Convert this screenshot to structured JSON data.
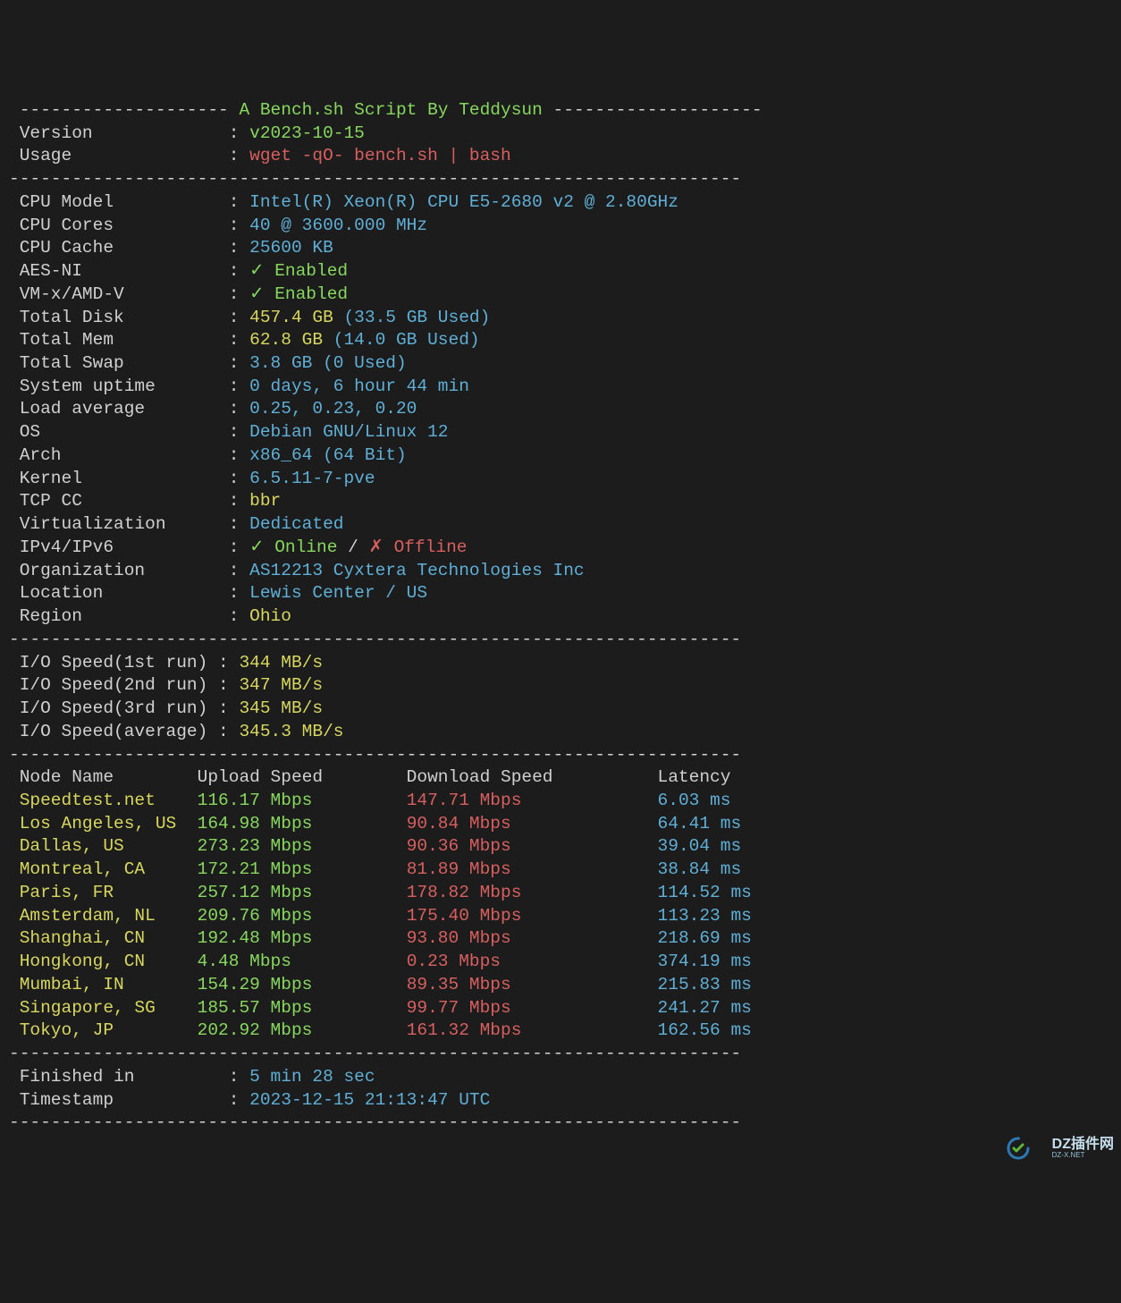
{
  "header": {
    "dash_left": "-------------------- ",
    "title": "A Bench.sh Script By Teddysun",
    "dash_right": " --------------------"
  },
  "version": {
    "label": "Version",
    "value": "v2023-10-15"
  },
  "usage": {
    "label": "Usage",
    "value": "wget -qO- bench.sh | bash"
  },
  "dash70": "----------------------------------------------------------------------",
  "sys": {
    "cpu_model": {
      "label": "CPU Model",
      "value": "Intel(R) Xeon(R) CPU E5-2680 v2 @ 2.80GHz"
    },
    "cpu_cores": {
      "label": "CPU Cores",
      "value": "40 @ 3600.000 MHz"
    },
    "cpu_cache": {
      "label": "CPU Cache",
      "value": "25600 KB"
    },
    "aes_ni": {
      "label": "AES-NI",
      "check": "✓",
      "value": "Enabled"
    },
    "vmx": {
      "label": "VM-x/AMD-V",
      "check": "✓",
      "value": "Enabled"
    },
    "total_disk": {
      "label": "Total Disk",
      "value": "457.4 GB",
      "used": "(33.5 GB Used)"
    },
    "total_mem": {
      "label": "Total Mem",
      "value": "62.8 GB",
      "used": "(14.0 GB Used)"
    },
    "total_swap": {
      "label": "Total Swap",
      "value": "3.8 GB (0 Used)"
    },
    "uptime": {
      "label": "System uptime",
      "value": "0 days, 6 hour 44 min"
    },
    "load": {
      "label": "Load average",
      "value": "0.25, 0.23, 0.20"
    },
    "os": {
      "label": "OS",
      "value": "Debian GNU/Linux 12"
    },
    "arch": {
      "label": "Arch",
      "value": "x86_64 (64 Bit)"
    },
    "kernel": {
      "label": "Kernel",
      "value": "6.5.11-7-pve"
    },
    "tcp_cc": {
      "label": "TCP CC",
      "value": "bbr"
    },
    "virt": {
      "label": "Virtualization",
      "value": "Dedicated"
    },
    "ipv": {
      "label": "IPv4/IPv6",
      "check1": "✓",
      "v1": "Online",
      "slash": " / ",
      "check2": "✗",
      "v2": "Offline"
    },
    "org": {
      "label": "Organization",
      "value": "AS12213 Cyxtera Technologies Inc"
    },
    "loc": {
      "label": "Location",
      "value": "Lewis Center / US"
    },
    "region": {
      "label": "Region",
      "value": "Ohio"
    }
  },
  "io": {
    "r1": {
      "label": "I/O Speed(1st run)",
      "value": "344 MB/s"
    },
    "r2": {
      "label": "I/O Speed(2nd run)",
      "value": "347 MB/s"
    },
    "r3": {
      "label": "I/O Speed(3rd run)",
      "value": "345 MB/s"
    },
    "avg": {
      "label": "I/O Speed(average)",
      "value": "345.3 MB/s"
    }
  },
  "speedtest": {
    "header": {
      "node": "Node Name",
      "up": "Upload Speed",
      "down": "Download Speed",
      "lat": "Latency"
    },
    "rows": [
      {
        "node": "Speedtest.net",
        "up": "116.17 Mbps",
        "down": "147.71 Mbps",
        "lat": "6.03 ms"
      },
      {
        "node": "Los Angeles, US",
        "up": "164.98 Mbps",
        "down": "90.84 Mbps",
        "lat": "64.41 ms"
      },
      {
        "node": "Dallas, US",
        "up": "273.23 Mbps",
        "down": "90.36 Mbps",
        "lat": "39.04 ms"
      },
      {
        "node": "Montreal, CA",
        "up": "172.21 Mbps",
        "down": "81.89 Mbps",
        "lat": "38.84 ms"
      },
      {
        "node": "Paris, FR",
        "up": "257.12 Mbps",
        "down": "178.82 Mbps",
        "lat": "114.52 ms"
      },
      {
        "node": "Amsterdam, NL",
        "up": "209.76 Mbps",
        "down": "175.40 Mbps",
        "lat": "113.23 ms"
      },
      {
        "node": "Shanghai, CN",
        "up": "192.48 Mbps",
        "down": "93.80 Mbps",
        "lat": "218.69 ms"
      },
      {
        "node": "Hongkong, CN",
        "up": "4.48 Mbps",
        "down": "0.23 Mbps",
        "lat": "374.19 ms"
      },
      {
        "node": "Mumbai, IN",
        "up": "154.29 Mbps",
        "down": "89.35 Mbps",
        "lat": "215.83 ms"
      },
      {
        "node": "Singapore, SG",
        "up": "185.57 Mbps",
        "down": "99.77 Mbps",
        "lat": "241.27 ms"
      },
      {
        "node": "Tokyo, JP",
        "up": "202.92 Mbps",
        "down": "161.32 Mbps",
        "lat": "162.56 ms"
      }
    ]
  },
  "footer": {
    "finished": {
      "label": "Finished in",
      "value": "5 min 28 sec"
    },
    "timestamp": {
      "label": "Timestamp",
      "value": "2023-12-15 21:13:47 UTC"
    }
  },
  "watermark": {
    "text": "DZ插件网",
    "sub": "DZ-X.NET"
  }
}
